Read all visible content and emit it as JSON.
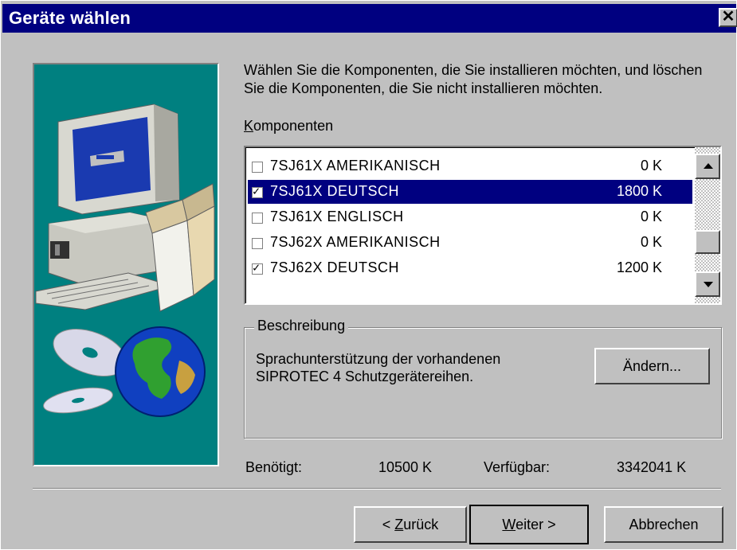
{
  "window": {
    "title": "Geräte wählen",
    "close_glyph": "✕"
  },
  "instruction": "Wählen Sie die Komponenten, die Sie installieren möchten, und löschen Sie die Komponenten, die Sie nicht installieren möchten.",
  "components": {
    "label_prefix": "K",
    "label_rest": "omponenten",
    "items": [
      {
        "name": "7SJ61X AMERIKANISCH",
        "size": "0 K",
        "checked": false,
        "selected": false
      },
      {
        "name": "7SJ61X DEUTSCH",
        "size": "1800 K",
        "checked": true,
        "selected": true
      },
      {
        "name": "7SJ61X ENGLISCH",
        "size": "0 K",
        "checked": false,
        "selected": false
      },
      {
        "name": "7SJ62X AMERIKANISCH",
        "size": "0 K",
        "checked": false,
        "selected": false
      },
      {
        "name": "7SJ62X DEUTSCH",
        "size": "1200 K",
        "checked": true,
        "selected": false
      }
    ]
  },
  "description": {
    "legend": "Beschreibung",
    "text_line1": "Sprachunterstützung der vorhandenen",
    "text_line2": "SIPROTEC 4 Schutzgerätereihen.",
    "change_button": "Ändern..."
  },
  "space": {
    "required_label": "Benötigt:",
    "required_value": "10500 K",
    "available_label": "Verfügbar:",
    "available_value": "3342041 K"
  },
  "buttons": {
    "back_prefix": "< ",
    "back_accel": "Z",
    "back_rest": "urück",
    "next_accel": "W",
    "next_rest": "eiter >",
    "cancel": "Abbrechen"
  },
  "colors": {
    "titlebar": "#000080",
    "face": "#c0c0c0",
    "illustration_bg": "#008080",
    "selection": "#000080"
  },
  "icons": [
    "computer-illustration",
    "cd-discs-illustration",
    "globe-illustration",
    "scroll-up-arrow-icon",
    "scroll-down-arrow-icon",
    "checkbox-check-icon"
  ]
}
